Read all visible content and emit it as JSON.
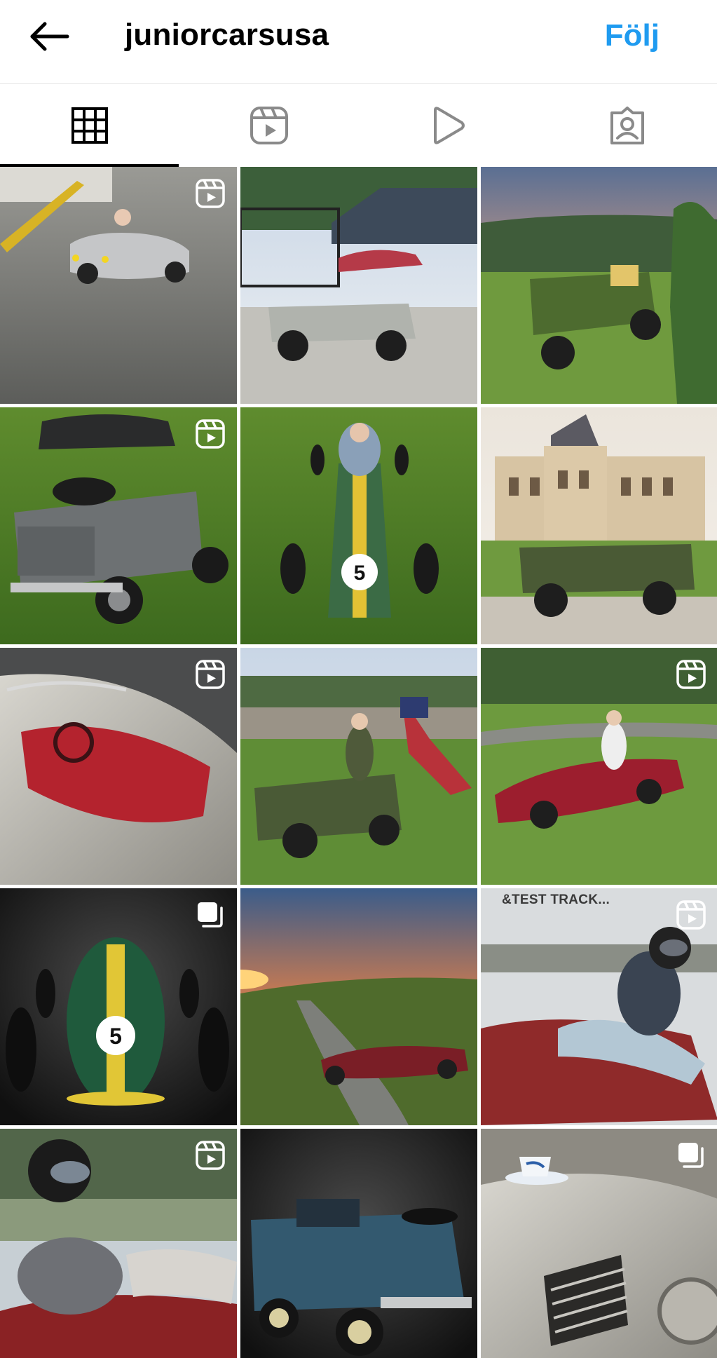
{
  "header": {
    "username": "juniorcarsusa",
    "follow_label": "Följ",
    "back_icon": "arrow-left-icon",
    "accent_color": "#1f9bf0"
  },
  "tabs": [
    {
      "name": "tab-grid",
      "icon": "grid-icon",
      "active": true
    },
    {
      "name": "tab-reels",
      "icon": "reels-icon",
      "active": false
    },
    {
      "name": "tab-videos",
      "icon": "play-icon",
      "active": false
    },
    {
      "name": "tab-tagged",
      "icon": "tagged-person-icon",
      "active": false
    }
  ],
  "posts": [
    {
      "subject": "grey-convertible-with-driver",
      "badge": "reel",
      "overlay_text": ""
    },
    {
      "subject": "grey-jeep-in-driveway",
      "badge": "none",
      "overlay_text": ""
    },
    {
      "subject": "green-land-rover-with-armored-figure",
      "badge": "none",
      "overlay_text": ""
    },
    {
      "subject": "grey-land-rover-on-lawn",
      "badge": "reel",
      "overlay_text": ""
    },
    {
      "subject": "green-race-car-number-5-with-child",
      "badge": "none",
      "overlay_text": ""
    },
    {
      "subject": "green-land-rover-by-chateau",
      "badge": "none",
      "overlay_text": ""
    },
    {
      "subject": "silver-car-red-interior",
      "badge": "reel",
      "overlay_text": ""
    },
    {
      "subject": "green-jeep-with-american-flag",
      "badge": "none",
      "overlay_text": ""
    },
    {
      "subject": "red-roadster-on-lawn",
      "badge": "reel",
      "overlay_text": ""
    },
    {
      "subject": "green-race-car-number-5-studio",
      "badge": "carousel",
      "overlay_text": ""
    },
    {
      "subject": "red-roadster-at-sunset",
      "badge": "none",
      "overlay_text": ""
    },
    {
      "subject": "driver-in-helmet-red-car",
      "badge": "reel",
      "overlay_text": "&TEST TRACK..."
    },
    {
      "subject": "driver-in-helmet-red-car-track",
      "badge": "reel",
      "overlay_text": ""
    },
    {
      "subject": "blue-land-rover-studio",
      "badge": "none",
      "overlay_text": ""
    },
    {
      "subject": "silver-car-with-teacup",
      "badge": "carousel",
      "overlay_text": ""
    }
  ]
}
